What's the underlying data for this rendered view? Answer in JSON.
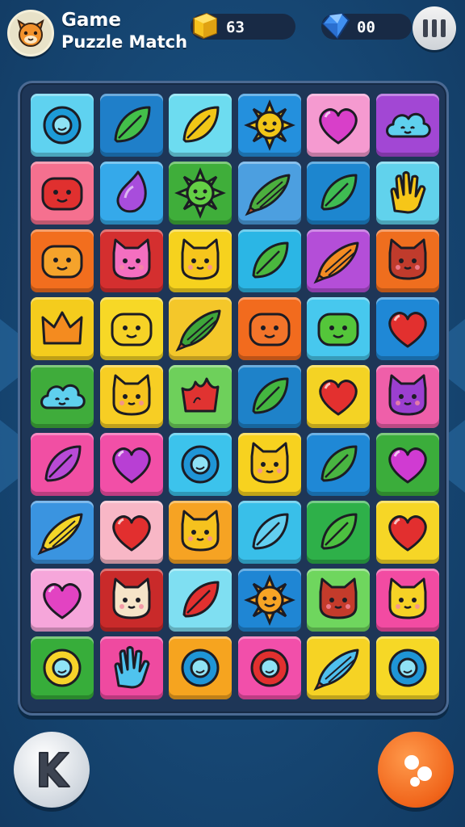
{
  "header": {
    "title_line1": "Game",
    "title_line2": "Puzzle Match",
    "coins": "63",
    "gems": "00",
    "avatar_icon": "cat-face-icon",
    "coin_icon": "gold-cube-icon",
    "gem_icon": "blue-diamond-icon",
    "pause_icon": "pause-icon"
  },
  "board": {
    "columns": 6,
    "rows": 9,
    "tiles": [
      [
        {
          "bg": "#5fd2f0",
          "icon": "ring",
          "fg": "#1d9bd8"
        },
        {
          "bg": "#1f7fc9",
          "icon": "leaf",
          "fg": "#43c04a"
        },
        {
          "bg": "#6ddcf0",
          "icon": "leaf",
          "fg": "#f2c617"
        },
        {
          "bg": "#2490dd",
          "icon": "sun",
          "fg": "#f2c617"
        },
        {
          "bg": "#f59ad0",
          "icon": "heart",
          "fg": "#d83fc9"
        },
        {
          "bg": "#a247d4",
          "icon": "cloud",
          "fg": "#5fd0ee"
        }
      ],
      [
        {
          "bg": "#f5708f",
          "icon": "face",
          "fg": "#e0302f"
        },
        {
          "bg": "#35a9ea",
          "icon": "drop",
          "fg": "#a84ddc"
        },
        {
          "bg": "#3fae3a",
          "icon": "sun",
          "fg": "#64cf45"
        },
        {
          "bg": "#4c9fe0",
          "icon": "pod",
          "fg": "#4cae3e"
        },
        {
          "bg": "#1d86cf",
          "icon": "leaf",
          "fg": "#3fbc52"
        },
        {
          "bg": "#61d2ec",
          "icon": "hand",
          "fg": "#f6c618"
        }
      ],
      [
        {
          "bg": "#f26e1e",
          "icon": "face",
          "fg": "#f5a32b"
        },
        {
          "bg": "#d42f2f",
          "icon": "cat",
          "fg": "#f46fc0"
        },
        {
          "bg": "#f6d21e",
          "icon": "cat",
          "fg": "#f6c51c"
        },
        {
          "bg": "#2bb6e5",
          "icon": "leaf",
          "fg": "#4ab73e"
        },
        {
          "bg": "#b44ed8",
          "icon": "pod",
          "fg": "#f38b22"
        },
        {
          "bg": "#ef6e1e",
          "icon": "cat",
          "fg": "#c03b2c"
        }
      ],
      [
        {
          "bg": "#f4cc1d",
          "icon": "crown",
          "fg": "#f48b1f"
        },
        {
          "bg": "#f7d826",
          "icon": "face",
          "fg": "#f6d226"
        },
        {
          "bg": "#f4c72a",
          "icon": "pod",
          "fg": "#3ea63a"
        },
        {
          "bg": "#f26b1e",
          "icon": "face",
          "fg": "#f3742a"
        },
        {
          "bg": "#47c8ee",
          "icon": "face",
          "fg": "#54c63a"
        },
        {
          "bg": "#1f88d6",
          "icon": "heart",
          "fg": "#e2302f"
        }
      ],
      [
        {
          "bg": "#3fac3b",
          "icon": "cloud",
          "fg": "#5fd0ee"
        },
        {
          "bg": "#f7ce24",
          "icon": "cat",
          "fg": "#f6c31e"
        },
        {
          "bg": "#6ed05b",
          "icon": "flame",
          "fg": "#e03331"
        },
        {
          "bg": "#1e82c9",
          "icon": "leaf",
          "fg": "#44b740"
        },
        {
          "bg": "#f4d324",
          "icon": "heart",
          "fg": "#e3302f"
        },
        {
          "bg": "#ef5fa9",
          "icon": "cat",
          "fg": "#9b3fd0"
        }
      ],
      [
        {
          "bg": "#f14fa3",
          "icon": "leaf",
          "fg": "#b84ad6"
        },
        {
          "bg": "#f24fa7",
          "icon": "heart",
          "fg": "#b83fd4"
        },
        {
          "bg": "#3cc3ec",
          "icon": "ring",
          "fg": "#1f95d6"
        },
        {
          "bg": "#f7d21f",
          "icon": "cat",
          "fg": "#f6c41e"
        },
        {
          "bg": "#1f88d6",
          "icon": "leaf",
          "fg": "#49b541"
        },
        {
          "bg": "#3bad3b",
          "icon": "heart",
          "fg": "#d03bd2"
        }
      ],
      [
        {
          "bg": "#3a94e0",
          "icon": "pod",
          "fg": "#f4d529"
        },
        {
          "bg": "#f8b7c6",
          "icon": "heart",
          "fg": "#e22f2f"
        },
        {
          "bg": "#f6a323",
          "icon": "cat",
          "fg": "#f6c21e"
        },
        {
          "bg": "#39bfe9",
          "icon": "leaf",
          "fg": "#63cff0"
        },
        {
          "bg": "#2eb049",
          "icon": "leaf",
          "fg": "#4cc040"
        },
        {
          "bg": "#f6d626",
          "icon": "heart",
          "fg": "#e22f2f"
        }
      ],
      [
        {
          "bg": "#f6a6da",
          "icon": "heart",
          "fg": "#e243c2"
        },
        {
          "bg": "#c92a2a",
          "icon": "cat",
          "fg": "#f6e4c8"
        },
        {
          "bg": "#7fdff2",
          "icon": "leaf",
          "fg": "#e2302f"
        },
        {
          "bg": "#1f86d4",
          "icon": "sun",
          "fg": "#f6a425"
        },
        {
          "bg": "#6fd65e",
          "icon": "cat",
          "fg": "#c43b2b"
        },
        {
          "bg": "#f24ba2",
          "icon": "cat",
          "fg": "#f6d226"
        }
      ],
      [
        {
          "bg": "#37ad3a",
          "icon": "ring",
          "fg": "#f6d32a"
        },
        {
          "bg": "#ef4aa0",
          "icon": "hand",
          "fg": "#4fc3ee"
        },
        {
          "bg": "#f6a41f",
          "icon": "ring",
          "fg": "#1f95d6"
        },
        {
          "bg": "#f24faa",
          "icon": "ring",
          "fg": "#e2302f"
        },
        {
          "bg": "#f6d324",
          "icon": "pod",
          "fg": "#4fbfee"
        },
        {
          "bg": "#f6d826",
          "icon": "ring",
          "fg": "#1f95d6"
        }
      ]
    ]
  },
  "footer": {
    "left_button_icon": "k-letter-icon",
    "right_button_icon": "dots-icon"
  }
}
